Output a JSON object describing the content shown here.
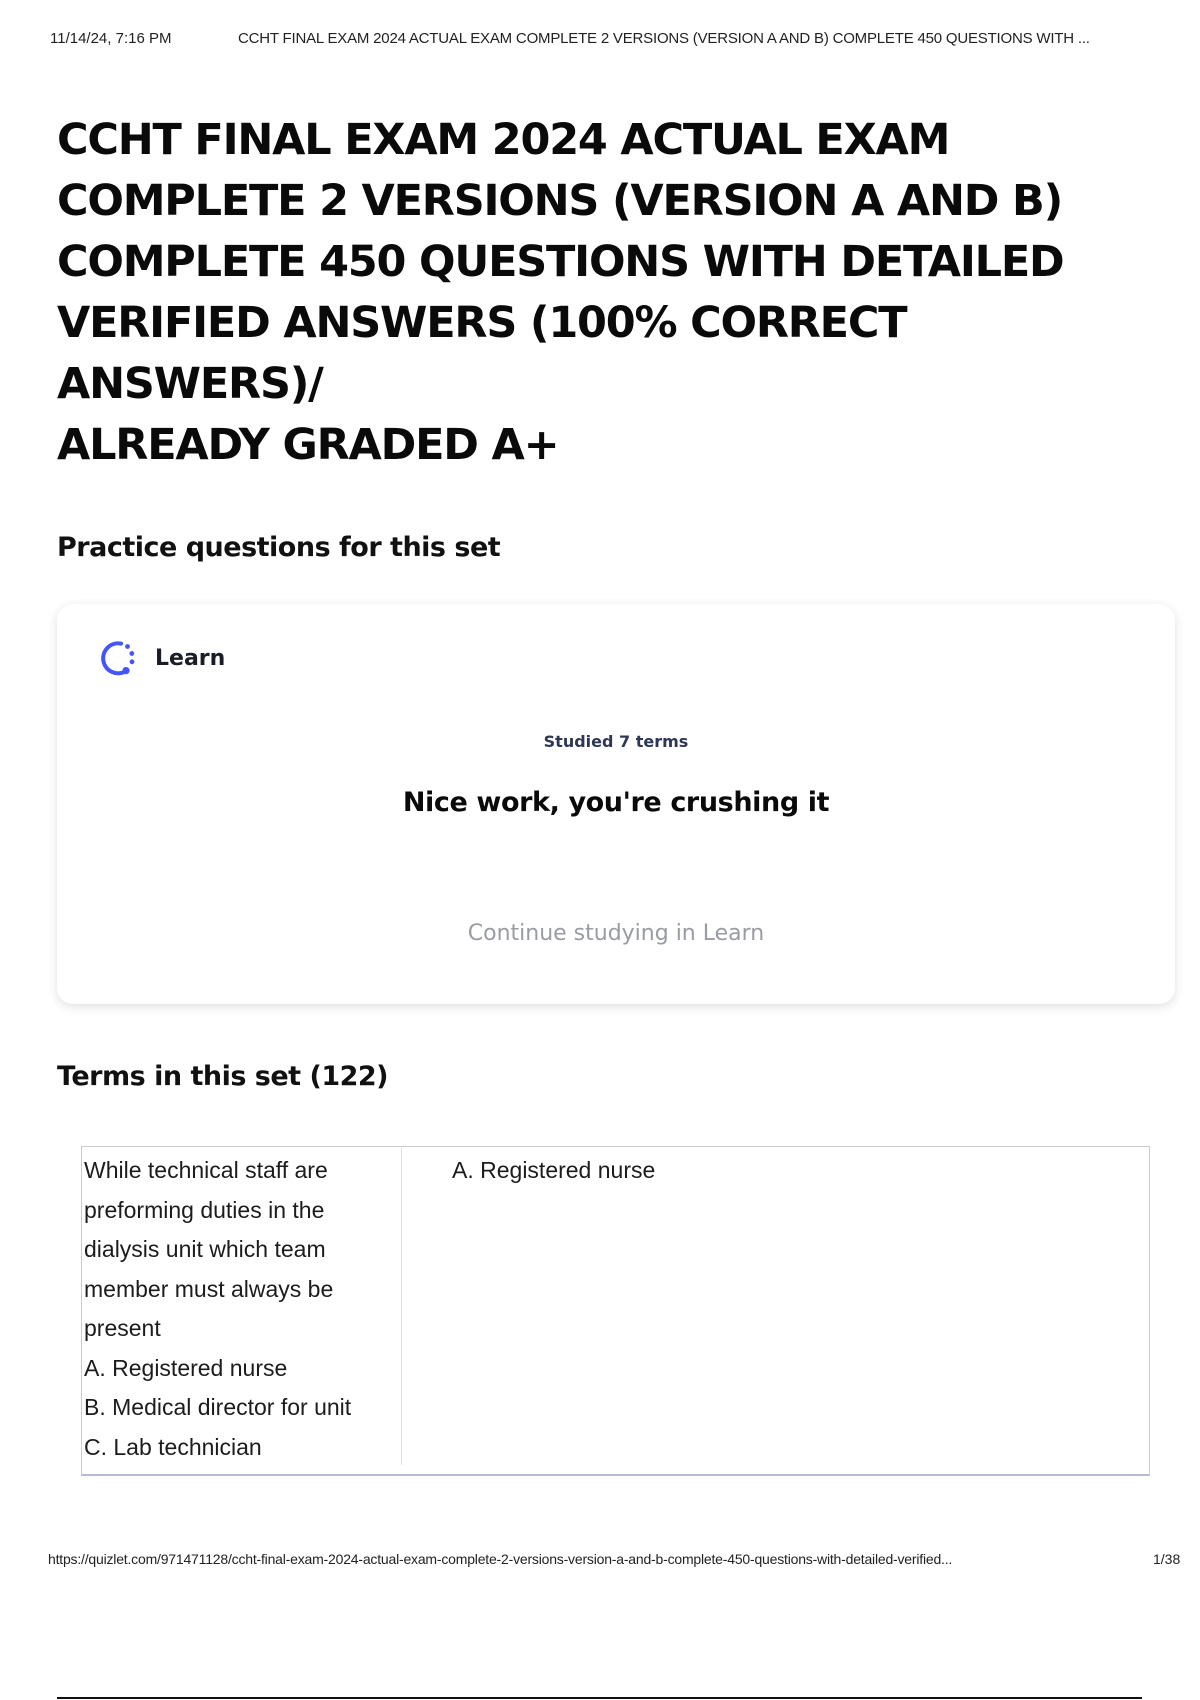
{
  "print_header": {
    "date": "11/14/24, 7:16 PM",
    "title": "CCHT FINAL EXAM 2024 ACTUAL EXAM COMPLETE 2 VERSIONS (VERSION A AND B) COMPLETE 450 QUESTIONS WITH ..."
  },
  "title_lines": [
    "CCHT FINAL EXAM 2024 ACTUAL EXAM",
    "COMPLETE 2 VERSIONS (VERSION A AND B)",
    "COMPLETE 450 QUESTIONS WITH DETAILED",
    "VERIFIED ANSWERS (100% CORRECT ANSWERS)/",
    "ALREADY GRADED A+"
  ],
  "practice": {
    "heading": "Practice questions for this set",
    "learn_label": "Learn",
    "learn_icon": "learn-progress-icon",
    "studied": "Studied 7 terms",
    "message": "Nice work, you're crushing it",
    "continue_label": "Continue studying in Learn",
    "accent_color": "#4255ff"
  },
  "terms": {
    "heading": "Terms in this set (122)",
    "items": [
      {
        "term_lines": [
          "While technical staff are",
          "preforming duties in the",
          "dialysis unit which team",
          "member must always be",
          "present",
          "A. Registered nurse",
          "B. Medical director for unit",
          "C. Lab technician"
        ],
        "definition": "A. Registered nurse"
      }
    ]
  },
  "print_footer": {
    "url": "https://quizlet.com/971471128/ccht-final-exam-2024-actual-exam-complete-2-versions-version-a-and-b-complete-450-questions-with-detailed-verified...",
    "page": "1/38"
  }
}
